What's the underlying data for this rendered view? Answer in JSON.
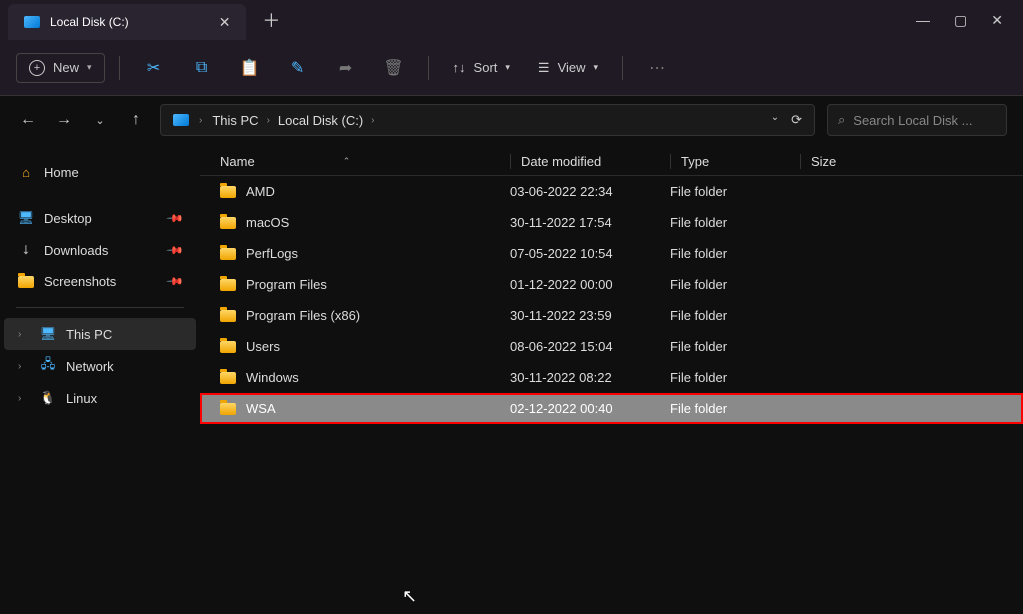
{
  "tab": {
    "title": "Local Disk (C:)"
  },
  "toolbar": {
    "new_label": "New",
    "sort_label": "Sort",
    "view_label": "View"
  },
  "breadcrumb": [
    "This PC",
    "Local Disk (C:)"
  ],
  "search": {
    "placeholder": "Search Local Disk ..."
  },
  "sidebar": {
    "home": "Home",
    "quick": [
      {
        "label": "Desktop",
        "icon": "monitor"
      },
      {
        "label": "Downloads",
        "icon": "download"
      },
      {
        "label": "Screenshots",
        "icon": "folder"
      }
    ],
    "locations": [
      {
        "label": "This PC",
        "icon": "pc",
        "active": true
      },
      {
        "label": "Network",
        "icon": "network",
        "active": false
      },
      {
        "label": "Linux",
        "icon": "linux",
        "active": false
      }
    ]
  },
  "columns": {
    "name": "Name",
    "date": "Date modified",
    "type": "Type",
    "size": "Size"
  },
  "rows": [
    {
      "name": "AMD",
      "date": "03-06-2022 22:34",
      "type": "File folder",
      "selected": false,
      "highlighted": false
    },
    {
      "name": "macOS",
      "date": "30-11-2022 17:54",
      "type": "File folder",
      "selected": false,
      "highlighted": false
    },
    {
      "name": "PerfLogs",
      "date": "07-05-2022 10:54",
      "type": "File folder",
      "selected": false,
      "highlighted": false
    },
    {
      "name": "Program Files",
      "date": "01-12-2022 00:00",
      "type": "File folder",
      "selected": false,
      "highlighted": false
    },
    {
      "name": "Program Files (x86)",
      "date": "30-11-2022 23:59",
      "type": "File folder",
      "selected": false,
      "highlighted": false
    },
    {
      "name": "Users",
      "date": "08-06-2022 15:04",
      "type": "File folder",
      "selected": false,
      "highlighted": false
    },
    {
      "name": "Windows",
      "date": "30-11-2022 08:22",
      "type": "File folder",
      "selected": false,
      "highlighted": false
    },
    {
      "name": "WSA",
      "date": "02-12-2022 00:40",
      "type": "File folder",
      "selected": true,
      "highlighted": true
    }
  ]
}
